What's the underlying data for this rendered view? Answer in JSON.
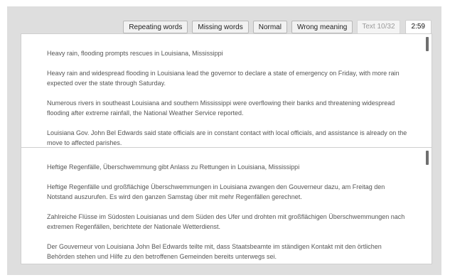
{
  "toolbar": {
    "repeating_words": "Repeating words",
    "missing_words": "Missing words",
    "normal": "Normal",
    "wrong_meaning": "Wrong meaning",
    "counter": "Text 10/32",
    "timer": "2:59"
  },
  "source": {
    "paragraphs": [
      "Heavy rain, flooding prompts rescues in Louisiana, Mississippi",
      "Heavy rain and widespread flooding in Louisiana lead the governor to declare a state of emergency on Friday, with more rain expected over the state through Saturday.",
      "Numerous rivers in southeast Louisiana and southern Mississippi were overflowing their banks and threatening widespread flooding after extreme rainfall, the National Weather Service reported.",
      "Louisiana Gov. John Bel Edwards said state officials are in constant contact with local officials, and assistance is already on the move to affected parishes."
    ]
  },
  "translation": {
    "paragraphs": [
      "Heftige Regenfälle, Überschwemmung gibt Anlass zu Rettungen in Louisiana, Mississippi",
      "Heftige Regenfälle und großflächige Überschwemmungen in Louisiana zwangen den Gouverneur dazu, am Freitag den Notstand auszurufen. Es wird den ganzen Samstag über mit mehr Regenfällen gerechnet.",
      "Zahlreiche Flüsse im Südosten Louisianas und dem Süden des Ufer und drohten mit großflächigen Überschwemmungen nach extremen Regenfällen, berichtete der Nationale Wetterdienst.",
      "Der Gouverneur von Louisiana John Bel Edwards teilte mit, dass Staatsbeamte im ständigen Kontakt mit den örtlichen Behörden stehen und Hilfe zu den betroffenen Gemeinden bereits unterwegs sei."
    ]
  }
}
